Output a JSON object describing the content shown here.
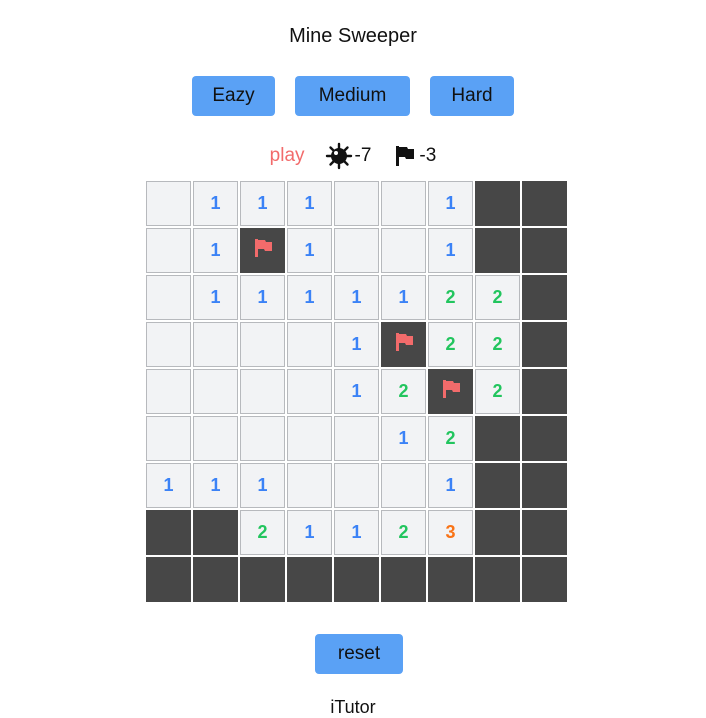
{
  "title": "Mine Sweeper",
  "levels": {
    "easy": "Eazy",
    "medium": "Medium",
    "hard": "Hard"
  },
  "status": {
    "state": "play",
    "mines": "-7",
    "flags": "-3"
  },
  "board": {
    "rows": [
      [
        "",
        "1",
        "1",
        "1",
        "",
        "",
        "1",
        "H",
        "H"
      ],
      [
        "",
        "1",
        "F",
        "1",
        "",
        "",
        "1",
        "H",
        "H"
      ],
      [
        "",
        "1",
        "1",
        "1",
        "1",
        "1",
        "2",
        "2",
        "H"
      ],
      [
        "",
        "",
        "",
        "",
        "1",
        "F",
        "2",
        "2",
        "H"
      ],
      [
        "",
        "",
        "",
        "",
        "1",
        "2",
        "F",
        "2",
        "H"
      ],
      [
        "",
        "",
        "",
        "",
        "",
        "1",
        "2",
        "H",
        "H"
      ],
      [
        "1",
        "1",
        "1",
        "",
        "",
        "",
        "1",
        "H",
        "H"
      ],
      [
        "H",
        "H",
        "2",
        "1",
        "1",
        "2",
        "3",
        "H",
        "H"
      ],
      [
        "H",
        "H",
        "H",
        "H",
        "H",
        "H",
        "H",
        "H",
        "H"
      ]
    ]
  },
  "icons": {
    "mine": "mine-icon",
    "flag": "flag-icon"
  },
  "colors": {
    "button": "#5aa1f5",
    "state": "#f26b6b",
    "hidden": "#474747",
    "open": "#f2f3f5",
    "flag": "#f26b6b",
    "n1": "#3b82f6",
    "n2": "#22c55e",
    "n3": "#f97316"
  },
  "reset_label": "reset",
  "footer": "iTutor"
}
